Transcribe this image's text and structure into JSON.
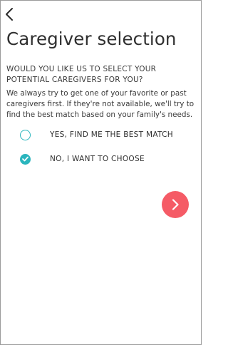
{
  "header": {
    "back_icon": "chevron-left-icon"
  },
  "page": {
    "title": "Caregiver selection",
    "question": "WOULD YOU LIKE US TO SELECT YOUR POTENTIAL CAREGIVERS FOR YOU?",
    "description": "We always try to get one of your favorite or past caregivers first. If they're not available, we'll try to find the best match based on your family's needs."
  },
  "options": [
    {
      "label": "YES, FIND ME THE BEST MATCH",
      "selected": false
    },
    {
      "label": "NO, I WANT TO CHOOSE",
      "selected": true
    }
  ],
  "next_button": {
    "icon": "chevron-right-icon",
    "color": "#f55b66"
  },
  "colors": {
    "accent": "#2ab5bd",
    "text": "#2f2f2f"
  }
}
